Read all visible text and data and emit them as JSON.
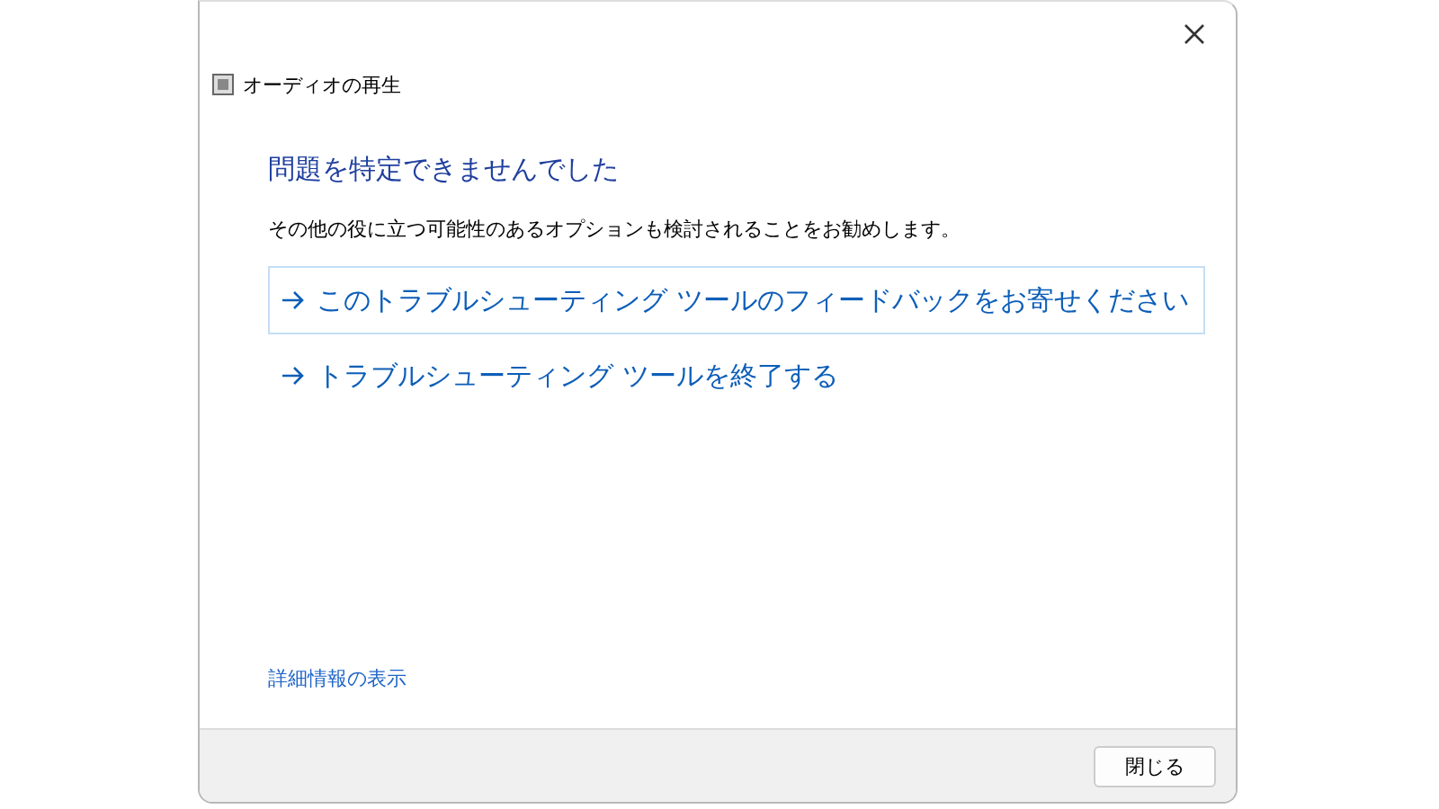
{
  "window": {
    "title": "オーディオの再生"
  },
  "heading": "問題を特定できませんでした",
  "description": "その他の役に立つ可能性のあるオプションも検討されることをお勧めします。",
  "options": [
    {
      "label": "このトラブルシューティング ツールのフィードバックをお寄せください",
      "selected": true
    },
    {
      "label": "トラブルシューティング ツールを終了する",
      "selected": false
    }
  ],
  "details_link": "詳細情報の表示",
  "buttons": [
    "閉じる"
  ]
}
